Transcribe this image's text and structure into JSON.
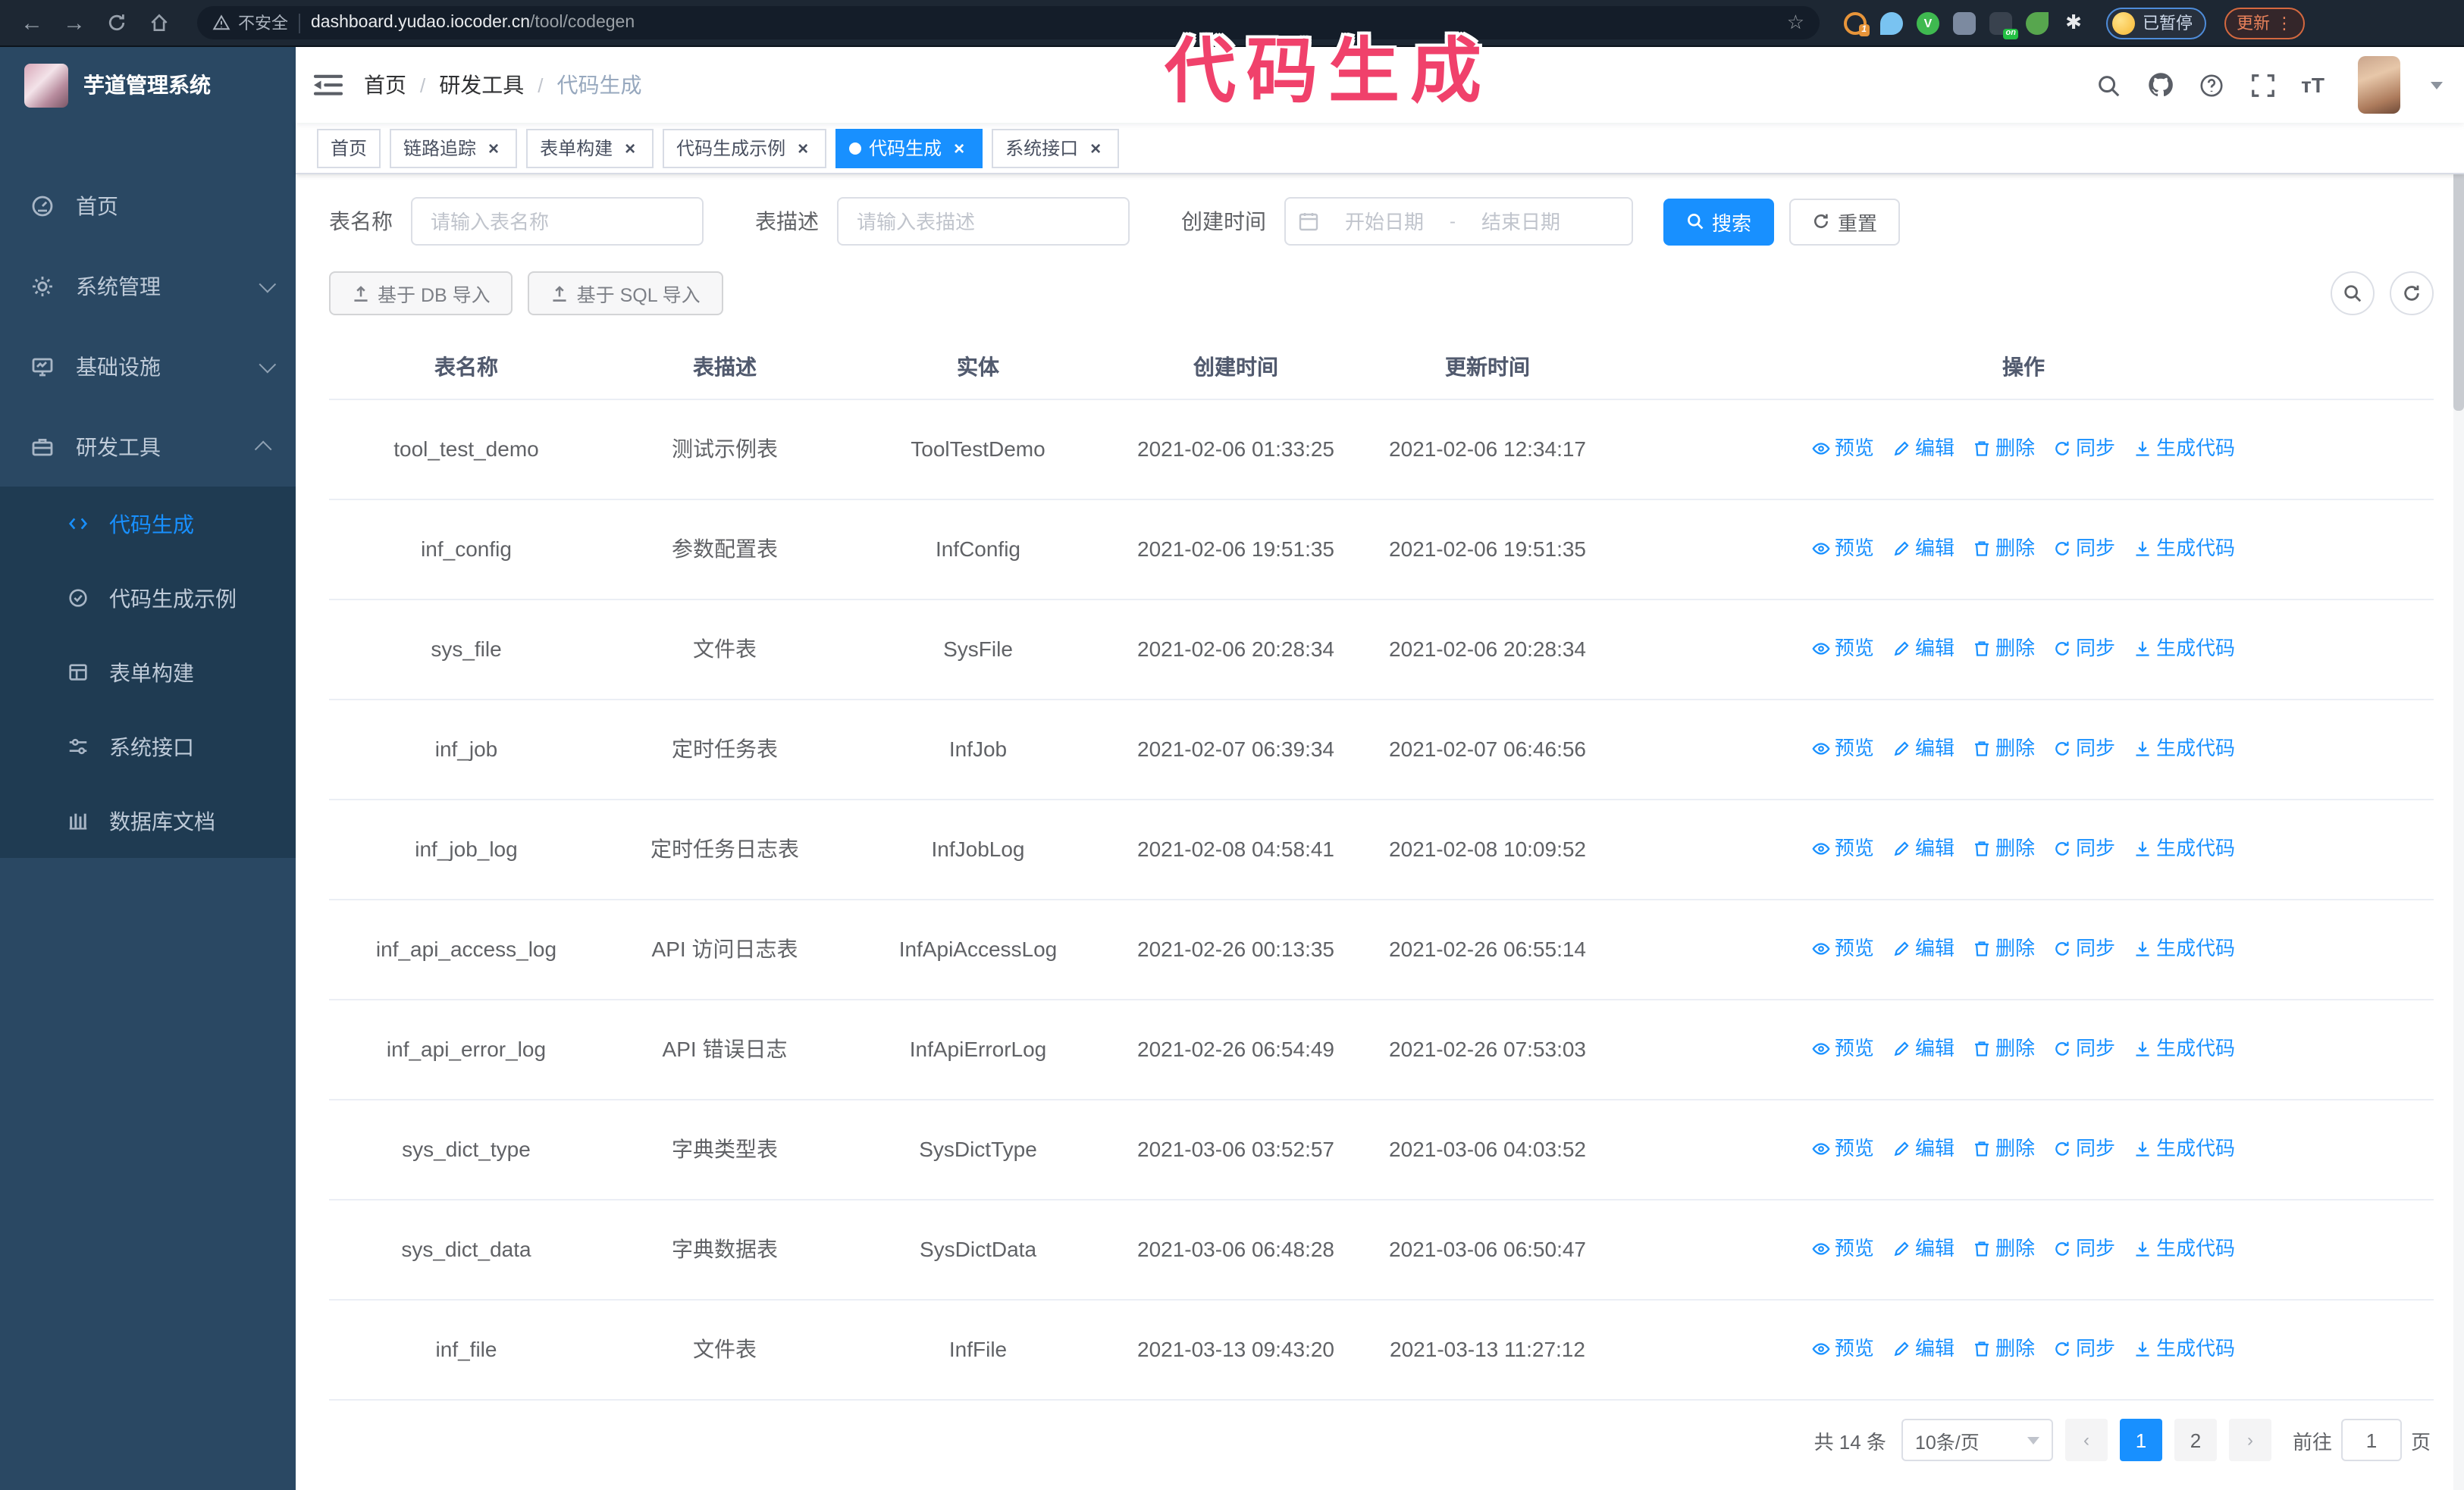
{
  "annotation": "代码生成",
  "browser": {
    "security_label": "不安全",
    "url_domain": "dashboard.yudao.iocoder.cn",
    "url_path": "/tool/codegen",
    "profile_chip": "已暂停",
    "update_button": "更新",
    "extension_on_badge": "on",
    "extension_count_badge": "1"
  },
  "sidebar": {
    "title": "芋道管理系统",
    "items": [
      {
        "label": "首页",
        "icon": "dashboard-icon"
      },
      {
        "label": "系统管理",
        "icon": "gear-icon"
      },
      {
        "label": "基础设施",
        "icon": "monitor-icon"
      },
      {
        "label": "研发工具",
        "icon": "toolbox-icon"
      }
    ],
    "subitems": [
      {
        "label": "代码生成",
        "icon": "code-icon",
        "active": true
      },
      {
        "label": "代码生成示例",
        "icon": "check-circle-icon",
        "active": false
      },
      {
        "label": "表单构建",
        "icon": "form-icon",
        "active": false
      },
      {
        "label": "系统接口",
        "icon": "sliders-icon",
        "active": false
      },
      {
        "label": "数据库文档",
        "icon": "columns-icon",
        "active": false
      }
    ]
  },
  "breadcrumb": {
    "items": [
      "首页",
      "研发工具",
      "代码生成"
    ],
    "separator": "/"
  },
  "tabs": [
    {
      "label": "首页",
      "closable": false,
      "active": false
    },
    {
      "label": "链路追踪",
      "closable": true,
      "active": false
    },
    {
      "label": "表单构建",
      "closable": true,
      "active": false
    },
    {
      "label": "代码生成示例",
      "closable": true,
      "active": false
    },
    {
      "label": "代码生成",
      "closable": true,
      "active": true
    },
    {
      "label": "系统接口",
      "closable": true,
      "active": false
    }
  ],
  "search_form": {
    "name_label": "表名称",
    "name_placeholder": "请输入表名称",
    "desc_label": "表描述",
    "desc_placeholder": "请输入表描述",
    "time_label": "创建时间",
    "start_placeholder": "开始日期",
    "range_separator": "-",
    "end_placeholder": "结束日期",
    "search_button": "搜索",
    "reset_button": "重置"
  },
  "toolbar": {
    "import_db_button": "基于 DB 导入",
    "import_sql_button": "基于 SQL 导入"
  },
  "table": {
    "headers": [
      "表名称",
      "表描述",
      "实体",
      "创建时间",
      "更新时间",
      "操作"
    ],
    "actions": [
      {
        "label": "预览",
        "icon": "eye-icon",
        "name": "preview-link"
      },
      {
        "label": "编辑",
        "icon": "edit-icon",
        "name": "edit-link"
      },
      {
        "label": "删除",
        "icon": "delete-icon",
        "name": "delete-link"
      },
      {
        "label": "同步",
        "icon": "sync-icon",
        "name": "sync-link"
      },
      {
        "label": "生成代码",
        "icon": "download-icon",
        "name": "generate-code-link"
      }
    ],
    "rows": [
      {
        "name": "tool_test_demo",
        "desc": "测试示例表",
        "entity": "ToolTestDemo",
        "created": "2021-02-06 01:33:25",
        "updated": "2021-02-06 12:34:17"
      },
      {
        "name": "inf_config",
        "desc": "参数配置表",
        "entity": "InfConfig",
        "created": "2021-02-06 19:51:35",
        "updated": "2021-02-06 19:51:35"
      },
      {
        "name": "sys_file",
        "desc": "文件表",
        "entity": "SysFile",
        "created": "2021-02-06 20:28:34",
        "updated": "2021-02-06 20:28:34"
      },
      {
        "name": "inf_job",
        "desc": "定时任务表",
        "entity": "InfJob",
        "created": "2021-02-07 06:39:34",
        "updated": "2021-02-07 06:46:56"
      },
      {
        "name": "inf_job_log",
        "desc": "定时任务日志表",
        "entity": "InfJobLog",
        "created": "2021-02-08 04:58:41",
        "updated": "2021-02-08 10:09:52"
      },
      {
        "name": "inf_api_access_log",
        "desc": "API 访问日志表",
        "entity": "InfApiAccessLog",
        "created": "2021-02-26 00:13:35",
        "updated": "2021-02-26 06:55:14"
      },
      {
        "name": "inf_api_error_log",
        "desc": "API 错误日志",
        "entity": "InfApiErrorLog",
        "created": "2021-02-26 06:54:49",
        "updated": "2021-02-26 07:53:03"
      },
      {
        "name": "sys_dict_type",
        "desc": "字典类型表",
        "entity": "SysDictType",
        "created": "2021-03-06 03:52:57",
        "updated": "2021-03-06 04:03:52"
      },
      {
        "name": "sys_dict_data",
        "desc": "字典数据表",
        "entity": "SysDictData",
        "created": "2021-03-06 06:48:28",
        "updated": "2021-03-06 06:50:47"
      },
      {
        "name": "inf_file",
        "desc": "文件表",
        "entity": "InfFile",
        "created": "2021-03-13 09:43:20",
        "updated": "2021-03-13 11:27:12"
      }
    ]
  },
  "pagination": {
    "total": "共 14 条",
    "page_size": "10条/页",
    "prev": "‹",
    "pages": [
      "1",
      "2"
    ],
    "active_page": "1",
    "next": "›",
    "goto_label": "前往",
    "goto_value": "1",
    "goto_suffix": "页"
  },
  "colors": {
    "primary": "#1890ff",
    "menu_bg": "#2a4863",
    "submenu_bg": "#1f3b52",
    "menu_text": "#bfcbd9",
    "active_tab_bg": "#1890ff",
    "annotation_pink": "#f0416b",
    "browser_bar_bg": "#1d2733",
    "table_border": "#ebeef5",
    "update_chip_orange": "#e8815a",
    "profile_chip_blue": "#4e8cd9"
  }
}
